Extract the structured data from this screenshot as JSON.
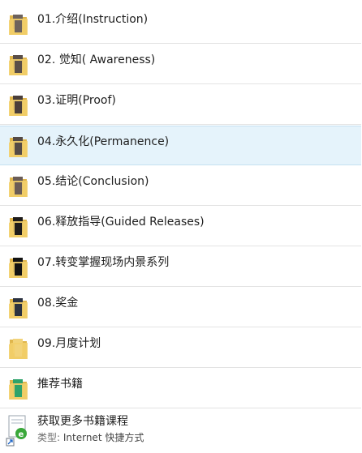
{
  "folders": [
    {
      "label": "01.介绍(Instruction)",
      "thumb": "#6d625c",
      "icon": "folder-icon"
    },
    {
      "label": "02. 觉知( Awareness)",
      "thumb": "#5a4e48",
      "icon": "folder-icon"
    },
    {
      "label": "03.证明(Proof)",
      "thumb": "#4a3e3a",
      "icon": "folder-icon"
    },
    {
      "label": "04.永久化(Permanence)",
      "thumb": "#544a46",
      "icon": "folder-icon"
    },
    {
      "label": "05.结论(Conclusion)",
      "thumb": "#6a5c56",
      "icon": "folder-icon"
    },
    {
      "label": "06.释放指导(Guided Releases)",
      "thumb": "#1d1b1a",
      "icon": "folder-icon"
    },
    {
      "label": "07.转变掌握现场内景系列",
      "thumb": "#121212",
      "icon": "folder-icon"
    },
    {
      "label": "08.奖金",
      "thumb": "#2b3240",
      "icon": "folder-icon"
    },
    {
      "label": "09.月度计划",
      "thumb": "#f2d37a",
      "icon": "folder-icon"
    },
    {
      "label": "推荐书籍",
      "thumb": "#2fa36b",
      "icon": "folder-icon"
    }
  ],
  "selected_index": 3,
  "shortcut": {
    "label": "获取更多书籍课程",
    "type_key": "类型:",
    "type_value": "Internet 快捷方式",
    "icon": "internet-shortcut-icon"
  },
  "colors": {
    "folder_body": "#f3cf6a",
    "folder_dark": "#e0b64c",
    "selected_bg": "#e5f3fb",
    "divider": "#e3e3e3"
  }
}
